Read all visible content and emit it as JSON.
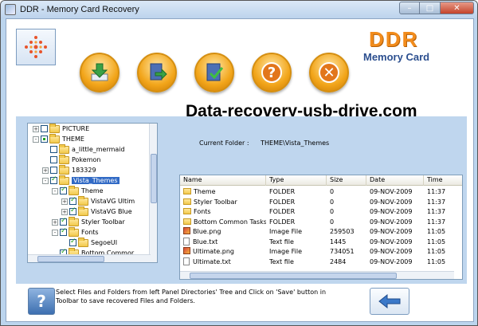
{
  "window": {
    "title": "DDR - Memory Card Recovery"
  },
  "brand": {
    "name": "DDR",
    "product": "Memory Card",
    "site": "Data-recovery-usb-drive.com"
  },
  "toolbar": [
    {
      "name": "save",
      "icon": "download-icon"
    },
    {
      "name": "open",
      "icon": "folder-arrow-icon"
    },
    {
      "name": "verify",
      "icon": "check-icon"
    },
    {
      "name": "help",
      "icon": "question-icon"
    },
    {
      "name": "exit",
      "icon": "close-icon"
    }
  ],
  "tree": [
    {
      "label": "PICTURE",
      "checked": "none",
      "expander": "+",
      "depth": 1
    },
    {
      "label": "THEME",
      "checked": "partial",
      "expander": "-",
      "depth": 1
    },
    {
      "label": "a_little_mermaid",
      "checked": "none",
      "expander": "",
      "depth": 2
    },
    {
      "label": "Pokemon",
      "checked": "none",
      "expander": "",
      "depth": 2
    },
    {
      "label": "183329",
      "checked": "none",
      "expander": "+",
      "depth": 2
    },
    {
      "label": "Vista_Themes",
      "checked": "checked",
      "expander": "-",
      "depth": 2,
      "selected": true
    },
    {
      "label": "Theme",
      "checked": "checked",
      "expander": "-",
      "depth": 3
    },
    {
      "label": "VistaVG Ultim",
      "checked": "checked",
      "expander": "+",
      "depth": 4
    },
    {
      "label": "VistaVG Blue",
      "checked": "checked",
      "expander": "+",
      "depth": 4
    },
    {
      "label": "Styler Toolbar",
      "checked": "checked",
      "expander": "+",
      "depth": 3
    },
    {
      "label": "Fonts",
      "checked": "checked",
      "expander": "-",
      "depth": 3
    },
    {
      "label": "SegoeUI",
      "checked": "checked",
      "expander": "",
      "depth": 4
    },
    {
      "label": "Bottom Commor",
      "checked": "checked",
      "expander": "",
      "depth": 3
    }
  ],
  "current_folder": {
    "label": "Current Folder :",
    "value": "THEME\\Vista_Themes"
  },
  "list": {
    "columns": [
      "Name",
      "Type",
      "Size",
      "Date",
      "Time"
    ],
    "rows": [
      {
        "name": "Theme",
        "type": "FOLDER",
        "size": "0",
        "date": "09-NOV-2009",
        "time": "11:37",
        "icon": "folder"
      },
      {
        "name": "Styler Toolbar",
        "type": "FOLDER",
        "size": "0",
        "date": "09-NOV-2009",
        "time": "11:37",
        "icon": "folder"
      },
      {
        "name": "Fonts",
        "type": "FOLDER",
        "size": "0",
        "date": "09-NOV-2009",
        "time": "11:37",
        "icon": "folder"
      },
      {
        "name": "Bottom Common Tasks",
        "type": "FOLDER",
        "size": "0",
        "date": "09-NOV-2009",
        "time": "11:37",
        "icon": "folder"
      },
      {
        "name": "Blue.png",
        "type": "Image File",
        "size": "259503",
        "date": "09-NOV-2009",
        "time": "11:05",
        "icon": "image"
      },
      {
        "name": "Blue.txt",
        "type": "Text file",
        "size": "1445",
        "date": "09-NOV-2009",
        "time": "11:05",
        "icon": "text"
      },
      {
        "name": "Ultimate.png",
        "type": "Image File",
        "size": "734051",
        "date": "09-NOV-2009",
        "time": "11:05",
        "icon": "image"
      },
      {
        "name": "Ultimate.txt",
        "type": "Text file",
        "size": "2484",
        "date": "09-NOV-2009",
        "time": "11:05",
        "icon": "text"
      }
    ]
  },
  "footer": {
    "info": "Select Files and Folders from left Panel Directories' Tree and Click on 'Save' button in Toolbar to save recovered Files and Folders."
  },
  "colors": {
    "accent": "#f28c1c",
    "panel": "#bfd6ee",
    "selection": "#316ac5"
  }
}
